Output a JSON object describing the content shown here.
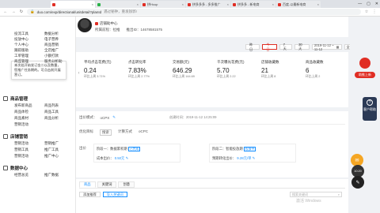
{
  "browser": {
    "tabs": [
      {
        "label": "",
        "color": "#e02e24",
        "active": true
      },
      {
        "label": "",
        "color": "#2ab249",
        "active": false
      },
      {
        "label": "拼Hcup",
        "color": "#e02e24",
        "active": false
      },
      {
        "label": "拼多多多 - 多多推广",
        "color": "#e02e24",
        "active": false
      },
      {
        "label": "拼多多 - 新电商",
        "color": "#e02e24",
        "active": false
      },
      {
        "label": "百度-以最新电商",
        "color": "#e02e24",
        "active": false
      }
    ],
    "url_prefix": "",
    "url_path": "duo.com/exp/directional/unitdetail?planId",
    "url_hint": "遇过秘钟，重发辦郭!"
  },
  "sidebar": {
    "rows_top": [
      {
        "a": "投流工具",
        "b": "数据分析"
      },
      {
        "a": "投放中心",
        "b": "电子营养"
      },
      {
        "a": "个人中心",
        "b": "商品营销"
      },
      {
        "a": "跟踪版助",
        "b": "全店推广"
      },
      {
        "a": "工单管理",
        "b": "小额打款"
      },
      {
        "a": "商品管理",
        "b": "服务分析助"
      }
    ],
    "tooltip": "本次处开始发订金二以及数量，您推广任务期的。可点击前开展营订。",
    "sections": [
      {
        "title": "商品管理",
        "icon": "box-icon",
        "rows": [
          {
            "a": "发布新商品",
            "b": "商品列表"
          },
          {
            "a": "商品体检",
            "b": "商品工具"
          },
          {
            "a": "商品素材",
            "b": "商品分析"
          },
          {
            "a": "营销活动",
            "b": ""
          }
        ]
      },
      {
        "title": "店铺营销",
        "icon": "store-icon",
        "rows": [
          {
            "a": "营销活动",
            "b": "营销推广"
          },
          {
            "a": "营销工具",
            "b": "推广工具"
          },
          {
            "a": "营销活动",
            "b": "推广中心"
          }
        ]
      },
      {
        "title": "数据中心",
        "icon": "chart-icon",
        "rows": [
          {
            "a": "经营总览",
            "b": "推广数据"
          }
        ]
      }
    ]
  },
  "header": {
    "shop_tag": "店铺助中心",
    "meta_a": "所属前程：拉推",
    "meta_b": "推出ID：14678581575"
  },
  "filters": {
    "buttons": [
      "昨日",
      "今日",
      "7天",
      "30天"
    ],
    "active_index": 1,
    "date_range": "2019-11-12 ~ 11-12",
    "date_icon": "calendar-icon",
    "select_value": "全部",
    "export": "数据导出"
  },
  "stats": [
    {
      "label": "平均点击花费(元)",
      "value": "0.24",
      "cmp": "环比上周 3.71%"
    },
    {
      "label": "点击转化率",
      "value": "7.83%",
      "cmp": "环比上周 2.77%"
    },
    {
      "label": "交易额(元)",
      "value": "646.29",
      "cmp": "环比上周 144.69"
    },
    {
      "label": "千次曝光花费(元)",
      "value": "5.70",
      "cmp": "环比上周 2.22"
    },
    {
      "label": "店铺收藏数",
      "value": "21",
      "cmp": "环比上周 8"
    },
    {
      "label": "商品收藏数",
      "value": "6",
      "cmp": "环比上周 2"
    }
  ],
  "plan": {
    "label": "出价模式：",
    "mode": "oCPX",
    "time": "创建时间：2019-11-12 14:25:09",
    "bid_label": "优化目标",
    "bid_chip": "搜索",
    "bid_type": "计算方式",
    "bid_value": "oCPC",
    "price_label": "出价",
    "stage1_title": "阶段一：数据累积期",
    "stage1_tag": "已完成",
    "stage1_sub": "成本出价：",
    "stage1_val": "0.50元",
    "stage2_title": "阶段二：智能投放期",
    "stage2_tag": "投放中",
    "stage2_sub": "预期转化出价：",
    "stage2_val": "9.28元/单"
  },
  "tabs": [
    "商品",
    "关键词",
    "创意"
  ],
  "sub_row": [
    "添加推荐",
    "导入关键词"
  ],
  "search_placeholder": "搜索关键词",
  "watermark": "激活 Windows",
  "floats": {
    "promo_label": "助推上新",
    "help_label": "客户帮助",
    "clock_label": "10:20"
  }
}
